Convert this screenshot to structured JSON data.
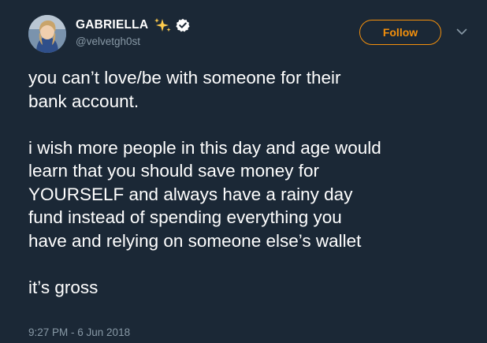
{
  "author": {
    "display_name": "GABRIELLA",
    "handle": "@velvetgh0st",
    "name_emoji": "sparkles-icon",
    "verified_badge": "verified-icon",
    "avatar": "avatar"
  },
  "actions": {
    "follow_label": "Follow",
    "menu_icon": "chevron-down-icon"
  },
  "tweet": {
    "lines": [
      "you can’t love/be with someone for their",
      "bank account.",
      "",
      "i wish more people in this day and age would",
      "learn that you should save money for",
      "YOURSELF and always have a rainy day",
      "fund instead of spending everything you",
      "have and relying on someone else’s wallet",
      "",
      "it’s gross"
    ],
    "timestamp": "9:27 PM - 6 Jun 2018"
  },
  "colors": {
    "background": "#1b2836",
    "text": "#ffffff",
    "muted": "#8899a6",
    "follow_accent": "#f4900c",
    "sparkle": "#ffcc4d"
  }
}
